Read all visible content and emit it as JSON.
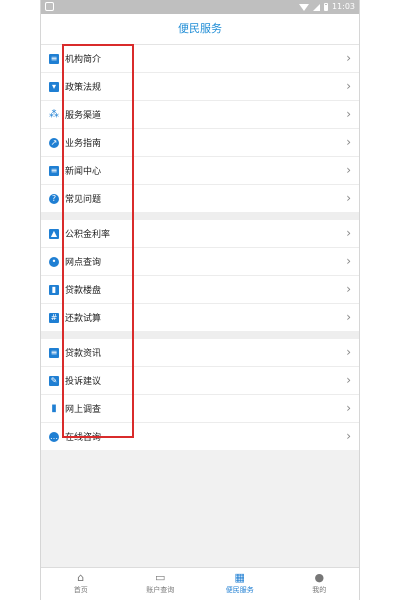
{
  "statusbar": {
    "time": "11:03"
  },
  "header": {
    "title": "便民服务"
  },
  "groups": [
    [
      {
        "label": "机构简介",
        "icon": "document-icon"
      },
      {
        "label": "政策法规",
        "icon": "bookmark-icon"
      },
      {
        "label": "服务渠道",
        "icon": "network-icon"
      },
      {
        "label": "业务指南",
        "icon": "compass-icon"
      },
      {
        "label": "新闻中心",
        "icon": "news-icon"
      },
      {
        "label": "常见问题",
        "icon": "question-icon"
      }
    ],
    [
      {
        "label": "公积金利率",
        "icon": "chart-icon"
      },
      {
        "label": "网点查询",
        "icon": "location-pin-icon"
      },
      {
        "label": "贷款楼盘",
        "icon": "building-icon"
      },
      {
        "label": "还款试算",
        "icon": "calculator-icon"
      }
    ],
    [
      {
        "label": "贷款资讯",
        "icon": "document-icon"
      },
      {
        "label": "投诉建议",
        "icon": "feedback-icon"
      },
      {
        "label": "网上调查",
        "icon": "bar-chart-icon"
      },
      {
        "label": "在线咨询",
        "icon": "chat-icon"
      }
    ]
  ],
  "tabs": [
    {
      "label": "首页",
      "icon": "home-icon",
      "active": false
    },
    {
      "label": "账户查询",
      "icon": "id-card-icon",
      "active": false
    },
    {
      "label": "便民服务",
      "icon": "grid-icon",
      "active": true
    },
    {
      "label": "我的",
      "icon": "person-icon",
      "active": false
    }
  ],
  "colors": {
    "accent": "#1f7fd3",
    "highlight": "#d92b2b"
  }
}
